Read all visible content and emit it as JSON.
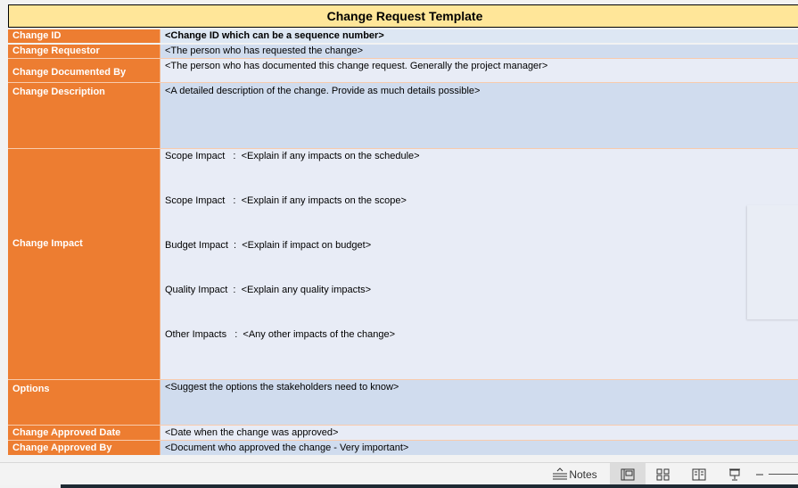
{
  "title": "Change Request Template",
  "rows": [
    {
      "label": "Change ID",
      "value": "<Change ID which can be a sequence number>"
    },
    {
      "label": "Change Requestor",
      "value": "<The person who has requested the change>"
    },
    {
      "label": "Change Documented By",
      "value": "<The person who has documented this change request. Generally the project manager>"
    },
    {
      "label": "Change Description",
      "value": "<A detailed description of the change. Provide as much details possible>"
    },
    {
      "label": "Change Impact",
      "impacts": [
        "Scope Impact   :  <Explain if any impacts on the schedule>",
        "Scope Impact   :  <Explain if any impacts on the scope>",
        "Budget Impact  :  <Explain if impact on budget>",
        "Quality Impact  :  <Explain any quality impacts>",
        "Other Impacts   :  <Any other impacts of the change>"
      ]
    },
    {
      "label": "Options",
      "value": "<Suggest the options the stakeholders need to know>"
    },
    {
      "label": "Change Approved Date",
      "value": "<Date when the change was approved>"
    },
    {
      "label": "Change Approved By",
      "value": "<Document who approved the change - Very important>"
    }
  ],
  "statusbar": {
    "notes_label": "Notes",
    "views": [
      "normal-view",
      "slide-sorter-view",
      "reading-view",
      "slideshow-view"
    ],
    "active_view": "normal-view"
  },
  "colors": {
    "label_bg": "#ed7d31",
    "title_bg": "#ffe699",
    "value_dark": "#d0dcee",
    "value_light": "#e8ecf6"
  }
}
